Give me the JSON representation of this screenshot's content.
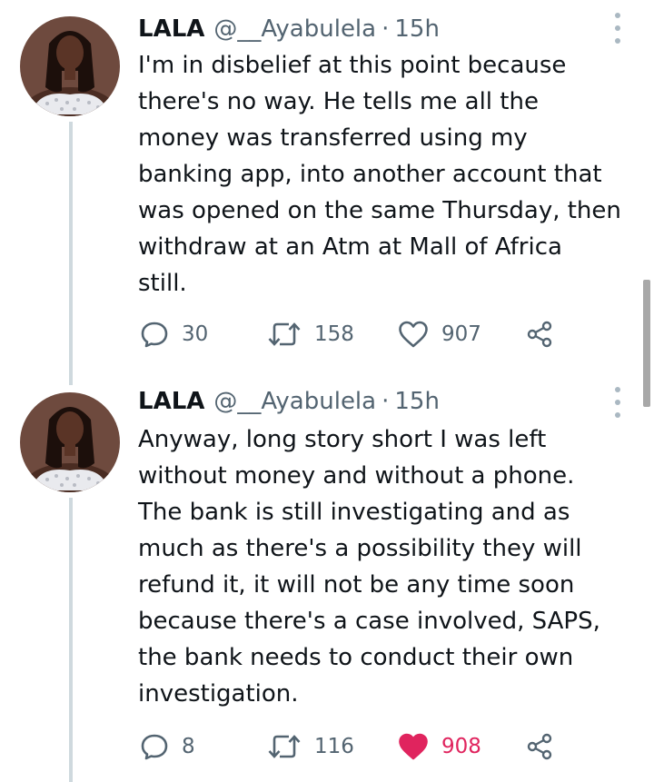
{
  "tweets": [
    {
      "display_name": "LALA",
      "handle": "@__Ayabulela",
      "separator": "·",
      "time": "15h",
      "text_lines": [
        "I'm in disbelief at this point because",
        "there's no way. He tells me all the",
        "money was transferred using my",
        "banking app, into another account that",
        "was opened on the same Thursday, then",
        "withdraw at an Atm at Mall of Africa",
        "still."
      ],
      "replies": "30",
      "retweets": "158",
      "likes": "907",
      "liked": false
    },
    {
      "display_name": "LALA",
      "handle": "@__Ayabulela",
      "separator": "·",
      "time": "15h",
      "text_lines": [
        "Anyway, long story short I was left",
        "without money and without a phone.",
        "The bank is still investigating and as",
        "much as there's a possibility they will",
        "refund it, it will not be any time soon",
        "because there's a case involved, SAPS,",
        "the bank needs to conduct their own",
        "investigation."
      ],
      "replies": "8",
      "retweets": "116",
      "likes": "908",
      "liked": true
    }
  ],
  "colors": {
    "text": "#0f1419",
    "secondary": "#536471",
    "like_active": "#e0245e",
    "thread_line": "#cfd9de"
  },
  "icons": {
    "reply": "speech-bubble-icon",
    "retweet": "retweet-arrows-icon",
    "like": "heart-icon",
    "share": "share-nodes-icon",
    "more": "vertical-ellipsis-icon"
  }
}
